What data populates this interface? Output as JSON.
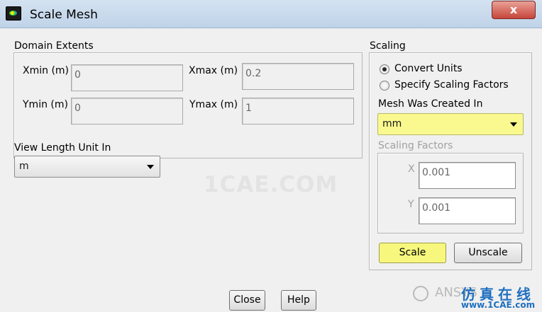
{
  "window": {
    "title": "Scale Mesh",
    "close_glyph": "x"
  },
  "domain_extents": {
    "label": "Domain Extents",
    "xmin_label": "Xmin (m)",
    "xmin_value": "0",
    "xmax_label": "Xmax (m)",
    "xmax_value": "0.2",
    "ymin_label": "Ymin (m)",
    "ymin_value": "0",
    "ymax_label": "Ymax (m)",
    "ymax_value": "1"
  },
  "view_length_unit": {
    "label": "View Length Unit In",
    "selected": "m"
  },
  "scaling": {
    "label": "Scaling",
    "options": [
      {
        "label": "Convert Units",
        "checked": true
      },
      {
        "label": "Specify Scaling Factors",
        "checked": false
      }
    ],
    "mesh_created_in": {
      "label": "Mesh Was Created In",
      "selected": "mm"
    },
    "factors": {
      "label": "Scaling Factors",
      "x_label": "X",
      "x_value": "0.001",
      "y_label": "Y",
      "y_value": "0.001"
    },
    "scale_button": "Scale",
    "unscale_button": "Unscale"
  },
  "footer": {
    "close_button": "Close",
    "help_button": "Help"
  },
  "watermarks": {
    "center": "1CAE.COM",
    "ansys": "ANSYS",
    "cn": "仿真在线",
    "site": "www.1CAE.com"
  },
  "colors": {
    "highlight_yellow": "#f7f77e",
    "close_red": "#c7453a"
  }
}
